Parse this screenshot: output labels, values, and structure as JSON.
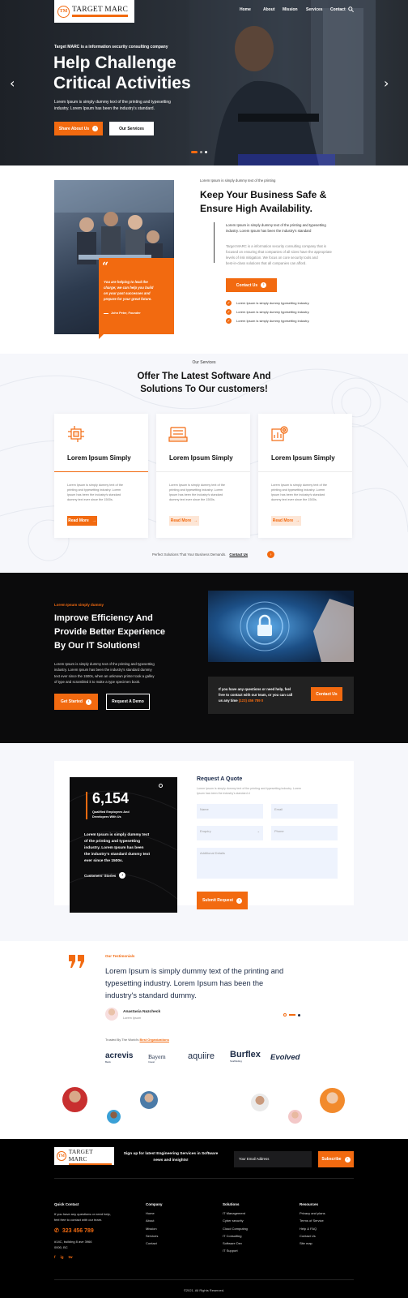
{
  "brand": {
    "name": "TARGET MARC",
    "mark": "TM",
    "accent": "#f26a10"
  },
  "nav": {
    "items": [
      "Home",
      "About",
      "Mission",
      "Services",
      "Contact"
    ]
  },
  "hero": {
    "eyebrow": "Target MARC is a information security consulting company",
    "title_line1": "Help Challenge",
    "title_line2": "Critical Activities",
    "text_line1": "Lorem Ipsum is simply dummy text of the printing and typesetting",
    "text_line2": "industry. Lorem Ipsum has been the industry's standard.",
    "btn_primary": "Share About Us",
    "btn_secondary": "Our Services",
    "prev_icon": "chevron-left-icon",
    "next_icon": "chevron-right-icon"
  },
  "about": {
    "eyebrow": "Lorem Ipsum is simply dummy text of the printing",
    "title_line1": "Keep Your Business Safe &",
    "title_line2": "Ensure High Availability.",
    "lead_line1": "Lorem Ipsum is simply dummy text of the printing and typesetting",
    "lead_line2": "industry. Lorem Ipsum has been the industry's standard",
    "body_line1": "Target MARC is a information security consulting company that is",
    "body_line2": "focused on ensuring that companies of all sizes have the appropriate",
    "body_line3": "levels of risk mitigation. We focus on core security tools and",
    "body_line4": "best-in-class solutions that all companies can afford.",
    "btn": "Contact Us",
    "checks": [
      "Lorem Ipsum is simply dummy typesetting industry.",
      "Lorem Ipsum is simply dummy typesetting industry.",
      "Lorem Ipsum is simply dummy typesetting industry."
    ],
    "quote_line1": "You are helping to lead the",
    "quote_line2": "charge; we can help you build",
    "quote_line3": "on your past successes and",
    "quote_line4": "prepare for your great future.",
    "quote_author": "John Peter, Founder"
  },
  "services": {
    "eyebrow": "Our Services",
    "title_line1": "Offer The Latest Software And",
    "title_line2": "Solutions To Our customers!",
    "cards": [
      {
        "title": "Lorem Ipsum Simply",
        "icon": "circuit-icon",
        "d1": "Lorem Ipsum is simply dummy text of the",
        "d2": "printing and typesetting industry. Lorem",
        "d3": "Ipsum has been the industry's standard",
        "d4": "dummy text ever since the 1500s.",
        "btn": "Read More"
      },
      {
        "title": "Lorem Ipsum Simply",
        "icon": "server-icon",
        "d1": "Lorem Ipsum is simply dummy text of the",
        "d2": "printing and typesetting industry. Lorem",
        "d3": "Ipsum has been the industry's standard",
        "d4": "dummy text ever since the 1500s.",
        "btn": "Read More"
      },
      {
        "title": "Lorem Ipsum Simply",
        "icon": "settings-chart-icon",
        "d1": "Lorem Ipsum is simply dummy text of the",
        "d2": "printing and typesetting industry. Lorem",
        "d3": "Ipsum has been the industry's standard",
        "d4": "dummy text ever since the 1500s.",
        "btn": "Read More"
      }
    ],
    "footer_text": "Perfect Solutions That Your Business Demands.",
    "footer_link": "Contact Us"
  },
  "efficiency": {
    "eyebrow": "Lorem Ipsum simply dummy",
    "title_line1": "Improve Efficiency And",
    "title_line2": "Provide Better Experience",
    "title_line3": "By Our IT Solutions!",
    "text_line1": "Lorem Ipsum is simply dummy text of the printing and typesetting",
    "text_line2": "industry. Lorem Ipsum has been the industry's standard dummy",
    "text_line3": "text ever since the 1500s, when an unknown printer took a galley",
    "text_line4": "of type and scrambled it to make a type specimen book.",
    "btn_primary": "Get Started",
    "btn_secondary": "Request A Demo",
    "help_line1": "If you have any questions or need help, feel",
    "help_line2": "free to contact with our team, or you can call",
    "help_line3": "us any time",
    "help_phone": "(123) 456 789 0",
    "help_btn": "Contact Us"
  },
  "quote": {
    "stat_value": "6,154",
    "stat_label_line1": "Qualified Employees And",
    "stat_label_line2": "Developers With Us",
    "stat_text_line1": "Lorem Ipsum is simply dummy text",
    "stat_text_line2": "of the printing and typesetting",
    "stat_text_line3": "industry. Lorem Ipsum has been",
    "stat_text_line4": "the industry's standard dummy text",
    "stat_text_line5": "ever since the 1500s.",
    "stories_link": "Customers' Stories",
    "title": "Request A Quote",
    "desc_line1": "Lorem Ipsum is simply dummy text of the printing and typesetting industry. Lorem",
    "desc_line2": "Ipsum has been the industry's standard d",
    "name_ph": "Name",
    "email_ph": "Email",
    "enquiry": "Enquiry",
    "phone_ph": "Phone",
    "details_ph": "Additional Details",
    "submit": "Submit Request"
  },
  "testimonials": {
    "eyebrow": "Our Testimonials",
    "quote_line1": "Lorem Ipsum is simply dummy text of the printing and",
    "quote_line2": "typesetting industry. Lorem Ipsum has been the",
    "quote_line3": "industry's standard dummy.",
    "author": "Anastasia Nazcheck",
    "role": "Lorem Ipsum",
    "trusted_prefix": "Trusted By The World's",
    "trusted_highlight": "Best Organizations",
    "partners": [
      {
        "name": "acrevis",
        "sub": "Bank"
      },
      {
        "name": "Bayern",
        "sub": "Invest"
      },
      {
        "name": "aquiire",
        "sub": ""
      },
      {
        "name": "Burflex",
        "sub": "Scaffolding"
      },
      {
        "name": "Evolved",
        "sub": ""
      }
    ]
  },
  "footer": {
    "signup_line1": "Sign up for latest Engineering Services in Software",
    "signup_line2": "news and insights!",
    "email_ph": "Your Email Address",
    "subscribe": "Subscribe",
    "quick_title": "Quick Contact",
    "quick_line1": "If you have any questions or need help,",
    "quick_line2": "feel free to contact with our team.",
    "phone": "323 456 789",
    "address_line1": "#14C, building 8 ave 3966",
    "address_line2": "0000, BC",
    "social": [
      "f",
      "ig",
      "tw"
    ],
    "company_title": "Company",
    "company": [
      "Home",
      "About",
      "Mission",
      "Services",
      "Contact"
    ],
    "solutions_title": "Solutions",
    "solutions": [
      "IT Management",
      "Cyber security",
      "Cloud Computing",
      "IT Consulting",
      "Software Dev",
      "IT Support"
    ],
    "resources_title": "Resources",
    "resources": [
      "Privacy and plans",
      "Terms of Service",
      "Help & FAQ",
      "Contact Us",
      "Site map"
    ],
    "copyright": "©2021. All Rights Reserved."
  }
}
